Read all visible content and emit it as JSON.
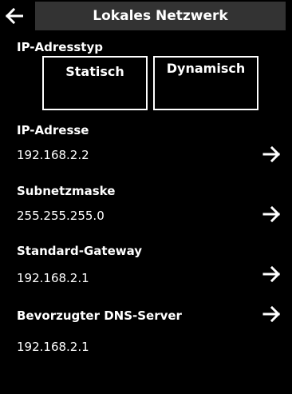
{
  "header": {
    "back_icon": "back-arrow-icon",
    "title": "Lokales Netzwerk",
    "title_bg": "#333333"
  },
  "ip_type": {
    "label": "IP-Adresstyp",
    "options": [
      "Statisch",
      "Dynamisch"
    ]
  },
  "fields": [
    {
      "label": "IP-Adresse",
      "value": "192.168.2.2",
      "icon": "forward-arrow-icon"
    },
    {
      "label": "Subnetzmaske",
      "value": "255.255.255.0",
      "icon": "forward-arrow-icon"
    },
    {
      "label": "Standard-Gateway",
      "value": "192.168.2.1",
      "icon": "forward-arrow-icon"
    },
    {
      "label": "Bevorzugter DNS-Server",
      "value": "192.168.2.1",
      "icon": "forward-arrow-icon"
    }
  ],
  "colors": {
    "background": "#000000",
    "text": "#ffffff"
  }
}
